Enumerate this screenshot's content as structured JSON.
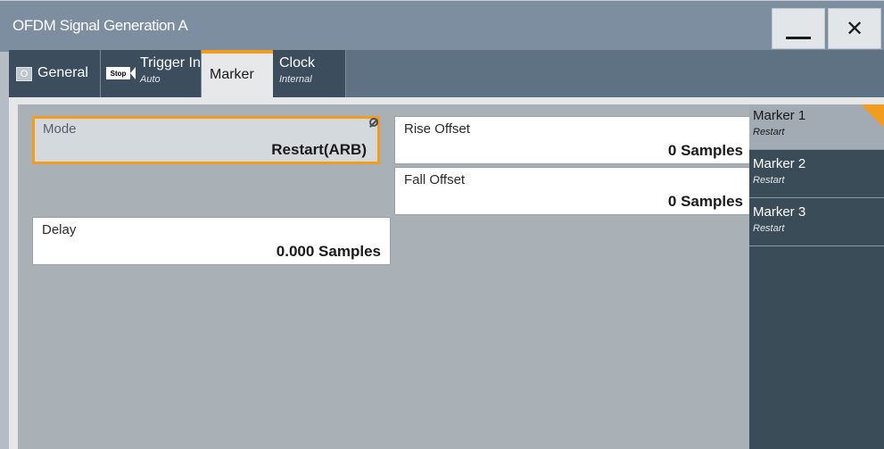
{
  "window": {
    "title": "OFDM Signal Generation A",
    "min_glyph": "",
    "close_glyph": "✕"
  },
  "tabs": {
    "general": {
      "label": "General",
      "onoff": "O"
    },
    "trigger": {
      "label": "Trigger In",
      "sub": "Auto",
      "badge": "Stop"
    },
    "marker": {
      "label": "Marker"
    },
    "clock": {
      "label": "Clock",
      "sub": "Internal"
    }
  },
  "fields": {
    "mode": {
      "label": "Mode",
      "value": "Restart(ARB)"
    },
    "rise_offset": {
      "label": "Rise Offset",
      "value": "0 Samples"
    },
    "fall_offset": {
      "label": "Fall Offset",
      "value": "0 Samples"
    },
    "delay": {
      "label": "Delay",
      "value": "0.000 Samples"
    }
  },
  "markers": [
    {
      "label": "Marker 1",
      "sub": "Restart"
    },
    {
      "label": "Marker 2",
      "sub": "Restart"
    },
    {
      "label": "Marker 3",
      "sub": "Restart"
    }
  ],
  "colors": {
    "accent": "#f29d1e",
    "titlebar": "#7d8ea1",
    "tab": "#3c4e5e",
    "panel": "#a9b0b6"
  }
}
